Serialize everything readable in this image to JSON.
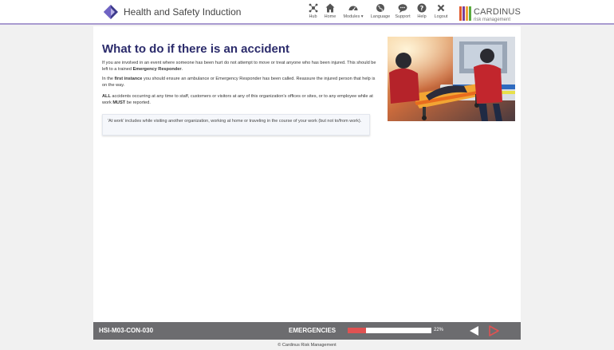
{
  "header": {
    "title": "Health and Safety Induction",
    "nav": [
      {
        "label": "Hub",
        "icon": "hub-icon"
      },
      {
        "label": "Home",
        "icon": "home-icon"
      },
      {
        "label": "Modules ▾",
        "icon": "modules-icon"
      },
      {
        "label": "Language",
        "icon": "globe-icon"
      },
      {
        "label": "Support",
        "icon": "chat-icon"
      },
      {
        "label": "Help",
        "icon": "help-icon"
      },
      {
        "label": "Logout",
        "icon": "close-icon"
      }
    ],
    "company": {
      "name": "CARDINUS",
      "sub": "risk management"
    },
    "colors": {
      "accent_border": "#a99bd0",
      "title": "#2b2b6b"
    }
  },
  "content": {
    "title": "What to do if there is an accident",
    "p1": {
      "text": "If you are involved in an event where someone has been hurt do not attempt to move or treat anyone who has been injured. This should be left to a trained ",
      "bold": "Emergency Responder",
      "end": "."
    },
    "p2": {
      "pre": "In the ",
      "bold": "first instance",
      "post": " you should ensure an ambulance or Emergency Responder has been called. Reassure the injured person that help is on the way."
    },
    "p3": {
      "bold1": "ALL",
      "mid": " accidents occurring at any time to staff, customers or visitors at any of this organization's offices or sites, or to any employee while at work ",
      "bold2": "MUST",
      "post": " be reported."
    },
    "note": "'At work' includes while visiting another organization, working at home or traveling in the course of your work (but not to/from work)."
  },
  "footer": {
    "screen_id": "HSI-M03-CON-030",
    "section": "EMERGENCIES",
    "progress_percent": 22,
    "progress_label": "22%",
    "colors": {
      "bar": "#6c6c6f",
      "fill": "#e05252",
      "next": "#e05252"
    }
  },
  "copyright": "© Cardinus Risk Management"
}
